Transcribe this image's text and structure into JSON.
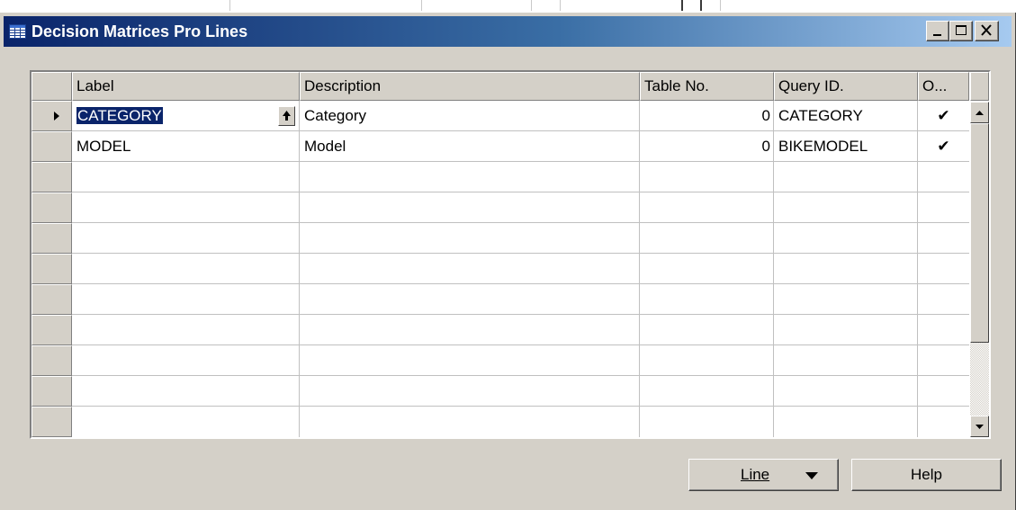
{
  "window": {
    "title": "Decision Matrices Pro Lines",
    "controls": {
      "minimize": "minimize",
      "maximize": "maximize",
      "close": "close"
    }
  },
  "table": {
    "columns": [
      "Label",
      "Description",
      "Table No.",
      "Query ID.",
      "O..."
    ],
    "rows": [
      {
        "label": "CATEGORY",
        "description": "Category",
        "table_no": "0",
        "query_id": "CATEGORY",
        "checked": "✔"
      },
      {
        "label": "MODEL",
        "description": "Model",
        "table_no": "0",
        "query_id": "BIKEMODEL",
        "checked": "✔"
      }
    ],
    "empty_rows": 9,
    "scroll_position": 0.0
  },
  "buttons": {
    "line": "Line",
    "help": "Help"
  },
  "colors": {
    "title_bar": "#0a246a",
    "title_bar_end": "#a6caf0",
    "face": "#d4d0c8",
    "selection": "#0a246a"
  },
  "icons": [
    "table-icon",
    "lookup-arrow-icon",
    "row-pointer-icon",
    "scroll-up-icon",
    "scroll-down-icon",
    "dropdown-arrow-icon"
  ]
}
